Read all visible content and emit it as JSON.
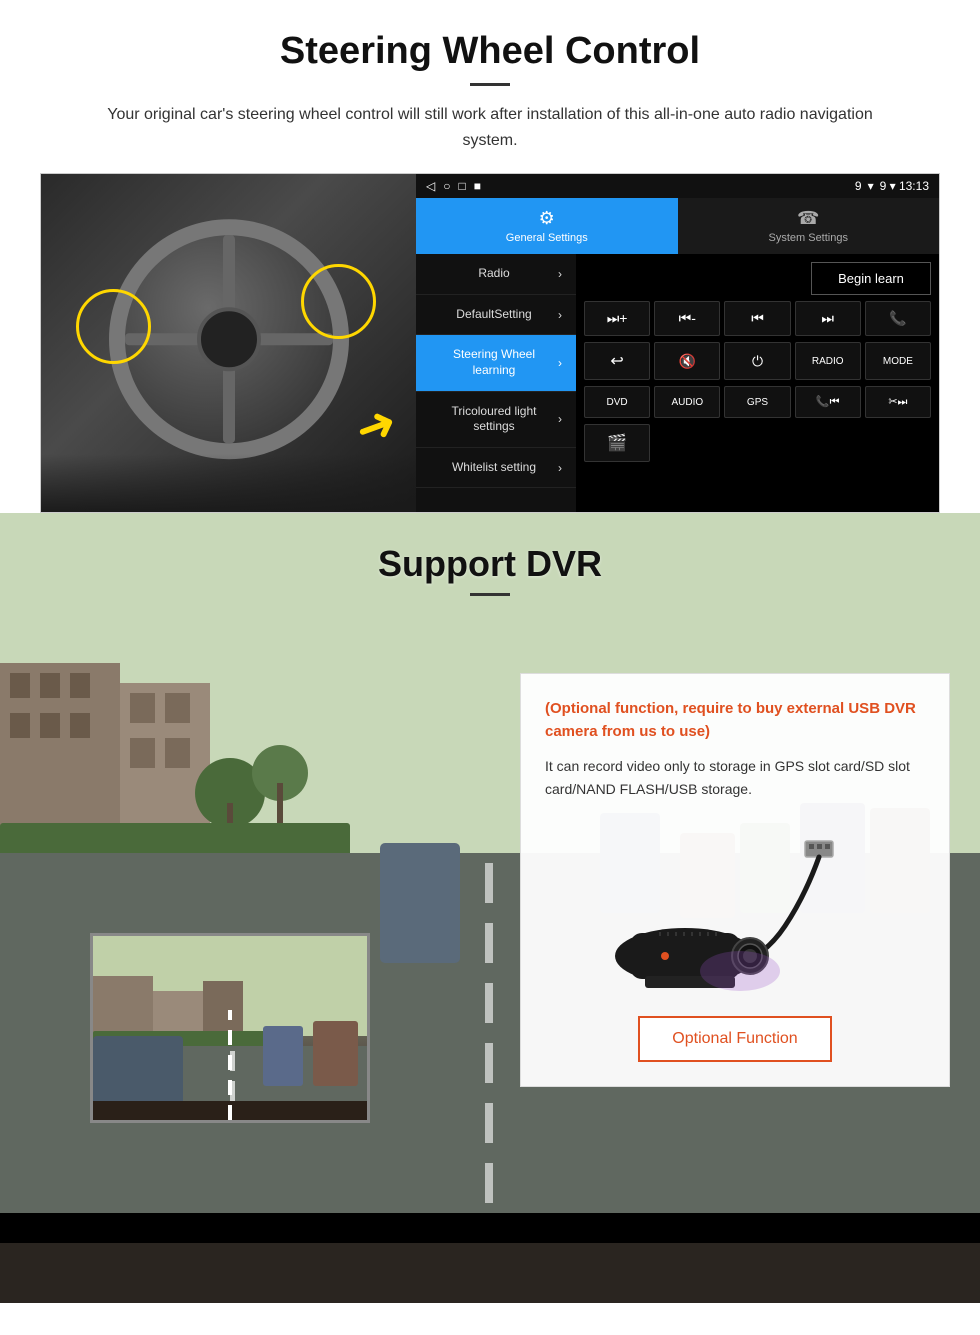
{
  "page": {
    "section1": {
      "title": "Steering Wheel Control",
      "description": "Your original car's steering wheel control will still work after installation of this all-in-one auto radio navigation system.",
      "android_ui": {
        "status_bar": {
          "nav_icons": [
            "◁",
            "○",
            "□",
            "■"
          ],
          "right_info": "9 ▾ 13:13"
        },
        "tabs": [
          {
            "icon": "⚙",
            "label": "General Settings",
            "active": true
          },
          {
            "icon": "☎",
            "label": "System Settings",
            "active": false
          }
        ],
        "menu_items": [
          {
            "label": "Radio",
            "active": false
          },
          {
            "label": "DefaultSetting",
            "active": false
          },
          {
            "label": "Steering Wheel learning",
            "active": true
          },
          {
            "label": "Tricoloured light settings",
            "active": false
          },
          {
            "label": "Whitelist setting",
            "active": false
          }
        ],
        "begin_learn_label": "Begin learn",
        "button_rows": [
          [
            "⏮+",
            "⏮-",
            "⏮⏮",
            "⏭⏭",
            "📞"
          ],
          [
            "↩",
            "🔇",
            "⏻",
            "RADIO",
            "MODE"
          ],
          [
            "DVD",
            "AUDIO",
            "GPS",
            "📞⏮",
            "✂⏭"
          ],
          [
            "🎬"
          ]
        ]
      }
    },
    "section2": {
      "title": "Support DVR",
      "optional_text": "(Optional function, require to buy external USB DVR camera from us to use)",
      "description": "It can record video only to storage in GPS slot card/SD slot card/NAND FLASH/USB storage.",
      "optional_function_btn": "Optional Function"
    }
  }
}
